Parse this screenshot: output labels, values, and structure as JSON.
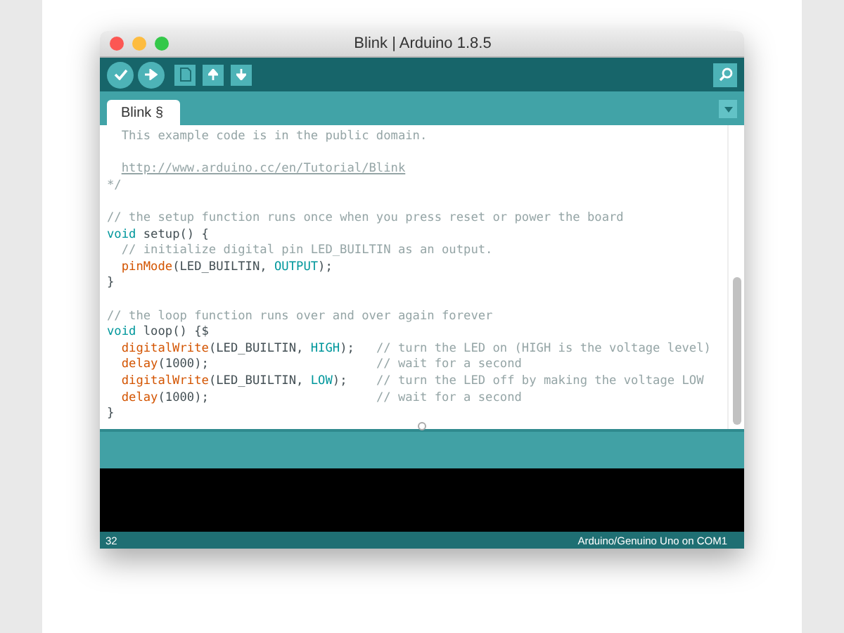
{
  "window": {
    "title": "Blink | Arduino 1.8.5"
  },
  "toolbar": {
    "buttons": [
      {
        "kind": "verify"
      },
      {
        "kind": "upload"
      },
      {
        "kind": "new"
      },
      {
        "kind": "open"
      },
      {
        "kind": "save"
      }
    ],
    "serial_monitor": {
      "kind": "monitor"
    }
  },
  "tabs": [
    {
      "label": "Blink §",
      "selected": true
    }
  ],
  "editor": {
    "lines": [
      {
        "space_before": false,
        "indent": true,
        "tokens": [
          {
            "kind": "comment",
            "text": "This example code is in the public domain."
          }
        ]
      },
      {
        "space_before": true,
        "indent": true,
        "tokens": [
          {
            "kind": "link",
            "text": "http://www.arduino.cc/en/Tutorial/Blink"
          }
        ]
      },
      {
        "space_before": false,
        "indent": false,
        "tokens": [
          {
            "kind": "comment",
            "text": "*/"
          }
        ]
      },
      {
        "space_before": true,
        "indent": false,
        "tokens": [
          {
            "kind": "comment",
            "text": "// the setup function runs once when you press reset or power the board"
          }
        ]
      },
      {
        "space_before": false,
        "indent": false,
        "tokens": [
          {
            "kind": "keyword",
            "text": "void"
          },
          {
            "kind": "plain",
            "text": " setup() {"
          }
        ]
      },
      {
        "space_before": false,
        "indent": true,
        "tokens": [
          {
            "kind": "comment",
            "text": "// initialize digital pin LED_BUILTIN as an output."
          }
        ]
      },
      {
        "space_before": false,
        "indent": true,
        "tokens": [
          {
            "kind": "function",
            "text": "pinMode"
          },
          {
            "kind": "plain",
            "text": "(LED_BUILTIN, "
          },
          {
            "kind": "constant",
            "text": "OUTPUT"
          },
          {
            "kind": "plain",
            "text": ");"
          }
        ]
      },
      {
        "space_before": false,
        "indent": false,
        "tokens": [
          {
            "kind": "plain",
            "text": "}"
          }
        ]
      },
      {
        "space_before": true,
        "indent": false,
        "tokens": [
          {
            "kind": "comment",
            "text": "// the loop function runs over and over again forever"
          }
        ]
      },
      {
        "space_before": false,
        "indent": false,
        "tokens": [
          {
            "kind": "keyword",
            "text": "void"
          },
          {
            "kind": "plain",
            "text": " loop() {$"
          }
        ]
      },
      {
        "space_before": false,
        "indent": true,
        "tokens": [
          {
            "kind": "function",
            "text": "digitalWrite"
          },
          {
            "kind": "plain",
            "text": "(LED_BUILTIN, "
          },
          {
            "kind": "constant",
            "text": "HIGH"
          },
          {
            "kind": "plain",
            "text": ");   "
          },
          {
            "kind": "comment",
            "text": "// turn the LED on (HIGH is the voltage level)"
          }
        ]
      },
      {
        "space_before": false,
        "indent": true,
        "tokens": [
          {
            "kind": "function",
            "text": "delay"
          },
          {
            "kind": "plain",
            "text": "(1000);                       "
          },
          {
            "kind": "comment",
            "text": "// wait for a second"
          }
        ]
      },
      {
        "space_before": false,
        "indent": true,
        "tokens": [
          {
            "kind": "function",
            "text": "digitalWrite"
          },
          {
            "kind": "plain",
            "text": "(LED_BUILTIN, "
          },
          {
            "kind": "constant",
            "text": "LOW"
          },
          {
            "kind": "plain",
            "text": ");    "
          },
          {
            "kind": "comment",
            "text": "// turn the LED off by making the voltage LOW"
          }
        ]
      },
      {
        "space_before": false,
        "indent": true,
        "tokens": [
          {
            "kind": "function",
            "text": "delay"
          },
          {
            "kind": "plain",
            "text": "(1000);                       "
          },
          {
            "kind": "comment",
            "text": "// wait for a second"
          }
        ]
      },
      {
        "space_before": false,
        "indent": false,
        "tokens": [
          {
            "kind": "plain",
            "text": "}"
          }
        ]
      }
    ]
  },
  "status_bar": {
    "line": "32",
    "board": "Arduino/Genuino Uno on COM1"
  }
}
